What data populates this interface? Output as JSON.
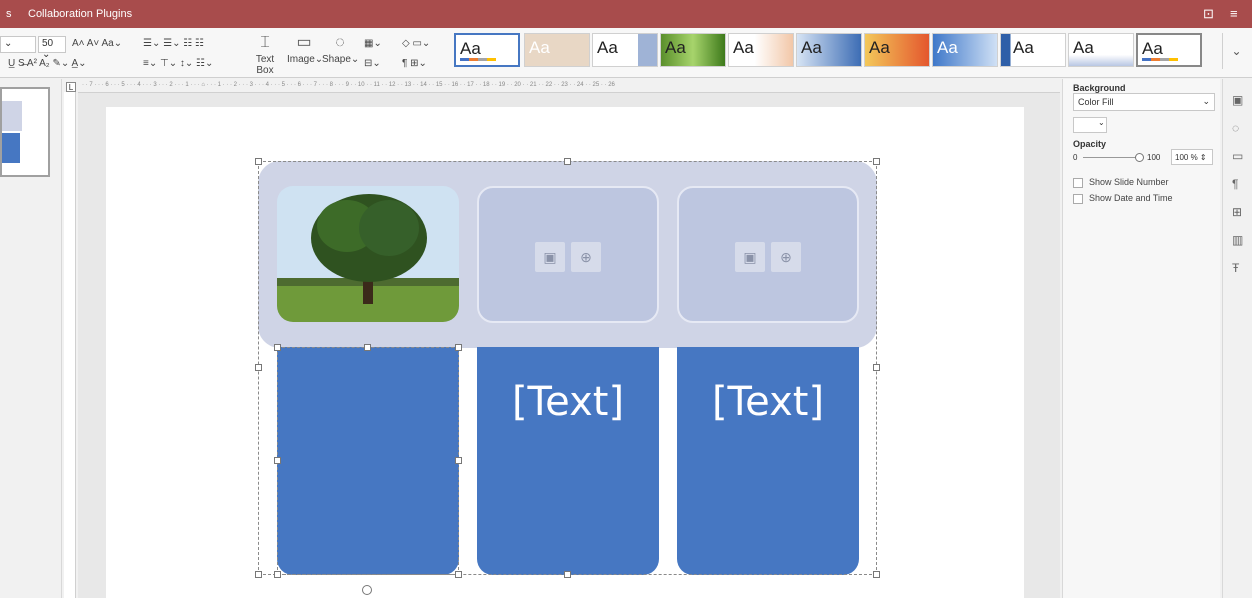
{
  "topbar": {
    "menus": [
      "s",
      "Collaboration",
      "Plugins"
    ]
  },
  "toolbar": {
    "font_size": "50",
    "text_box": "Text Box",
    "image": "Image",
    "shape": "Shape",
    "theme_label": "Aa"
  },
  "slide": {
    "card_texts": [
      "",
      "[Text]",
      "[Text]"
    ]
  },
  "right_panel": {
    "background_label": "Background",
    "fill_type": "Color Fill",
    "opacity_label": "Opacity",
    "opacity_min": "0",
    "opacity_max": "100",
    "opacity_value": "100 %",
    "show_slide_number": "Show Slide Number",
    "show_date_time": "Show Date and Time"
  },
  "colors": {
    "accent": "#a84c4c",
    "card": "#4677c2",
    "banner": "#cfd4e6"
  }
}
